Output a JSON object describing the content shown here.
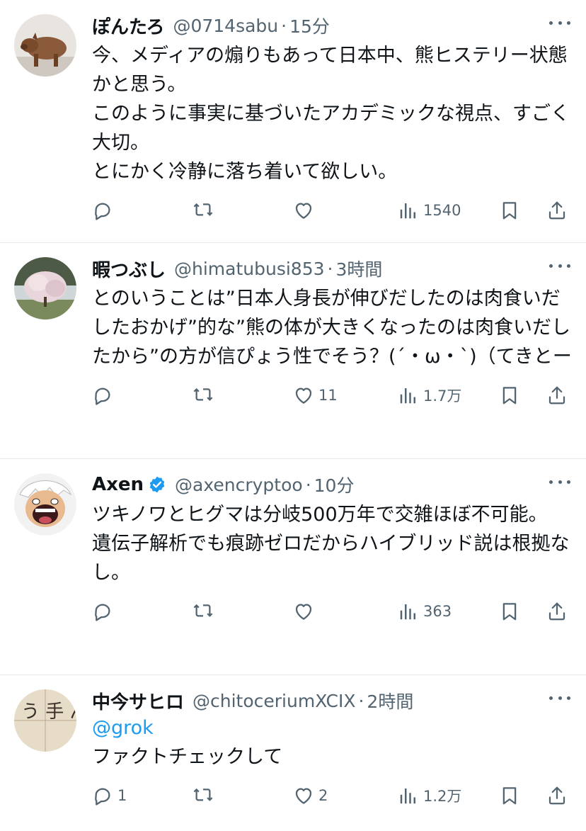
{
  "colors": {
    "text": "#0f1419",
    "secondary": "#536471",
    "accent": "#1d9bf0",
    "divider": "#e7e9ea"
  },
  "tweets": [
    {
      "name": "ぽんたろ",
      "handle": "@0714sabu",
      "sep": "·",
      "time": "15分",
      "verified": false,
      "mention": "",
      "text": "今、メディアの煽りもあって日本中、熊ヒステリー状態かと思う。\nこのように事実に基づいたアカデミックな視点、すごく大切。\nとにかく冷静に落ち着いて欲しい。",
      "replies": "",
      "retweets": "",
      "likes": "",
      "views": "1540",
      "avatar_icon": "boar-figurine-avatar"
    },
    {
      "name": "暇つぶし",
      "handle": "@himatubusi853",
      "sep": "·",
      "time": "3時間",
      "verified": false,
      "mention": "",
      "text": "とのいうことは”日本人身長が伸びだしたのは肉食いだしたおかげ”的な”熊の体が大きくなったのは肉食いだしたから”の方が信ぴょう性でそう？(´・ω・`)（てきとー",
      "replies": "",
      "retweets": "",
      "likes": "11",
      "views": "1.7万",
      "avatar_icon": "cherry-tree-avatar"
    },
    {
      "name": "Axen",
      "handle": "@axencryptoo",
      "sep": "·",
      "time": "10分",
      "verified": true,
      "mention": "",
      "text": "ツキノワとヒグマは分岐500万年で交雑ほぼ不可能。\n遺伝子解析でも痕跡ゼロだからハイブリッド説は根拠なし。",
      "replies": "",
      "retweets": "",
      "likes": "",
      "views": "363",
      "avatar_icon": "anime-character-avatar"
    },
    {
      "name": "中今サヒロ",
      "handle": "@chitoceriumXCIX",
      "sep": "·",
      "time": "2時間",
      "verified": false,
      "mention": "@grok",
      "text": "ファクトチェックして",
      "replies": "1",
      "retweets": "",
      "likes": "2",
      "views": "1.2万",
      "avatar_icon": "handwriting-avatar",
      "avatar_text": "う 手 ん ち"
    }
  ]
}
